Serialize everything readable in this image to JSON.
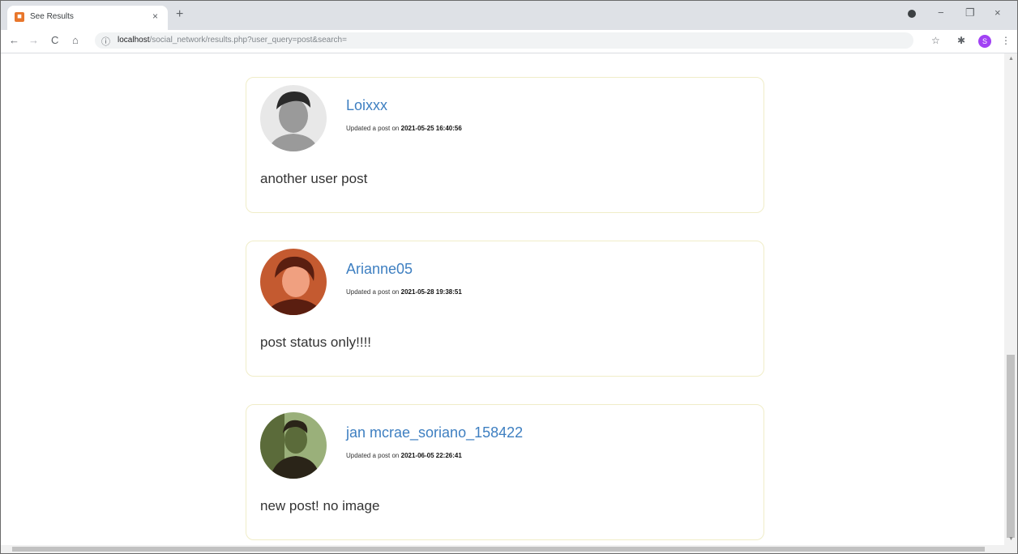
{
  "browser": {
    "tab": {
      "title": "See Results",
      "close_glyph": "×"
    },
    "new_tab_glyph": "+",
    "window_controls": {
      "minimize": "−",
      "restore": "❐",
      "close": "×"
    },
    "nav": {
      "back": "←",
      "forward": "→",
      "reload": "C",
      "home": "⌂"
    },
    "address": {
      "info_glyph": "ⓘ",
      "host": "localhost",
      "path": "/social_network/results.php?user_query=post&search="
    },
    "toolbar_icons": {
      "star": "☆",
      "extensions": "✱",
      "menu": "⋮"
    },
    "profile_initial": "S"
  },
  "posts": [
    {
      "username": "Loixxx",
      "meta_prefix": "Updated a post on",
      "timestamp": "2021-05-25 16:40:56",
      "body": "another user post",
      "avatar_colors": [
        "#e8e8e8",
        "#9a9a9a",
        "#2a2a2a"
      ]
    },
    {
      "username": "Arianne05",
      "meta_prefix": "Updated a post on",
      "timestamp": "2021-05-28 19:38:51",
      "body": "post status only!!!!",
      "avatar_colors": [
        "#f0a080",
        "#c45a30",
        "#5a1e10"
      ]
    },
    {
      "username": "jan mcrae_soriano_158422",
      "meta_prefix": "Updated a post on",
      "timestamp": "2021-06-05 22:26:41",
      "body": "new post! no image",
      "avatar_colors": [
        "#9ab07a",
        "#5b6b3a",
        "#2a2418"
      ]
    }
  ],
  "colors": {
    "link": "#3e7fc1",
    "card_border": "#f0edc8"
  }
}
